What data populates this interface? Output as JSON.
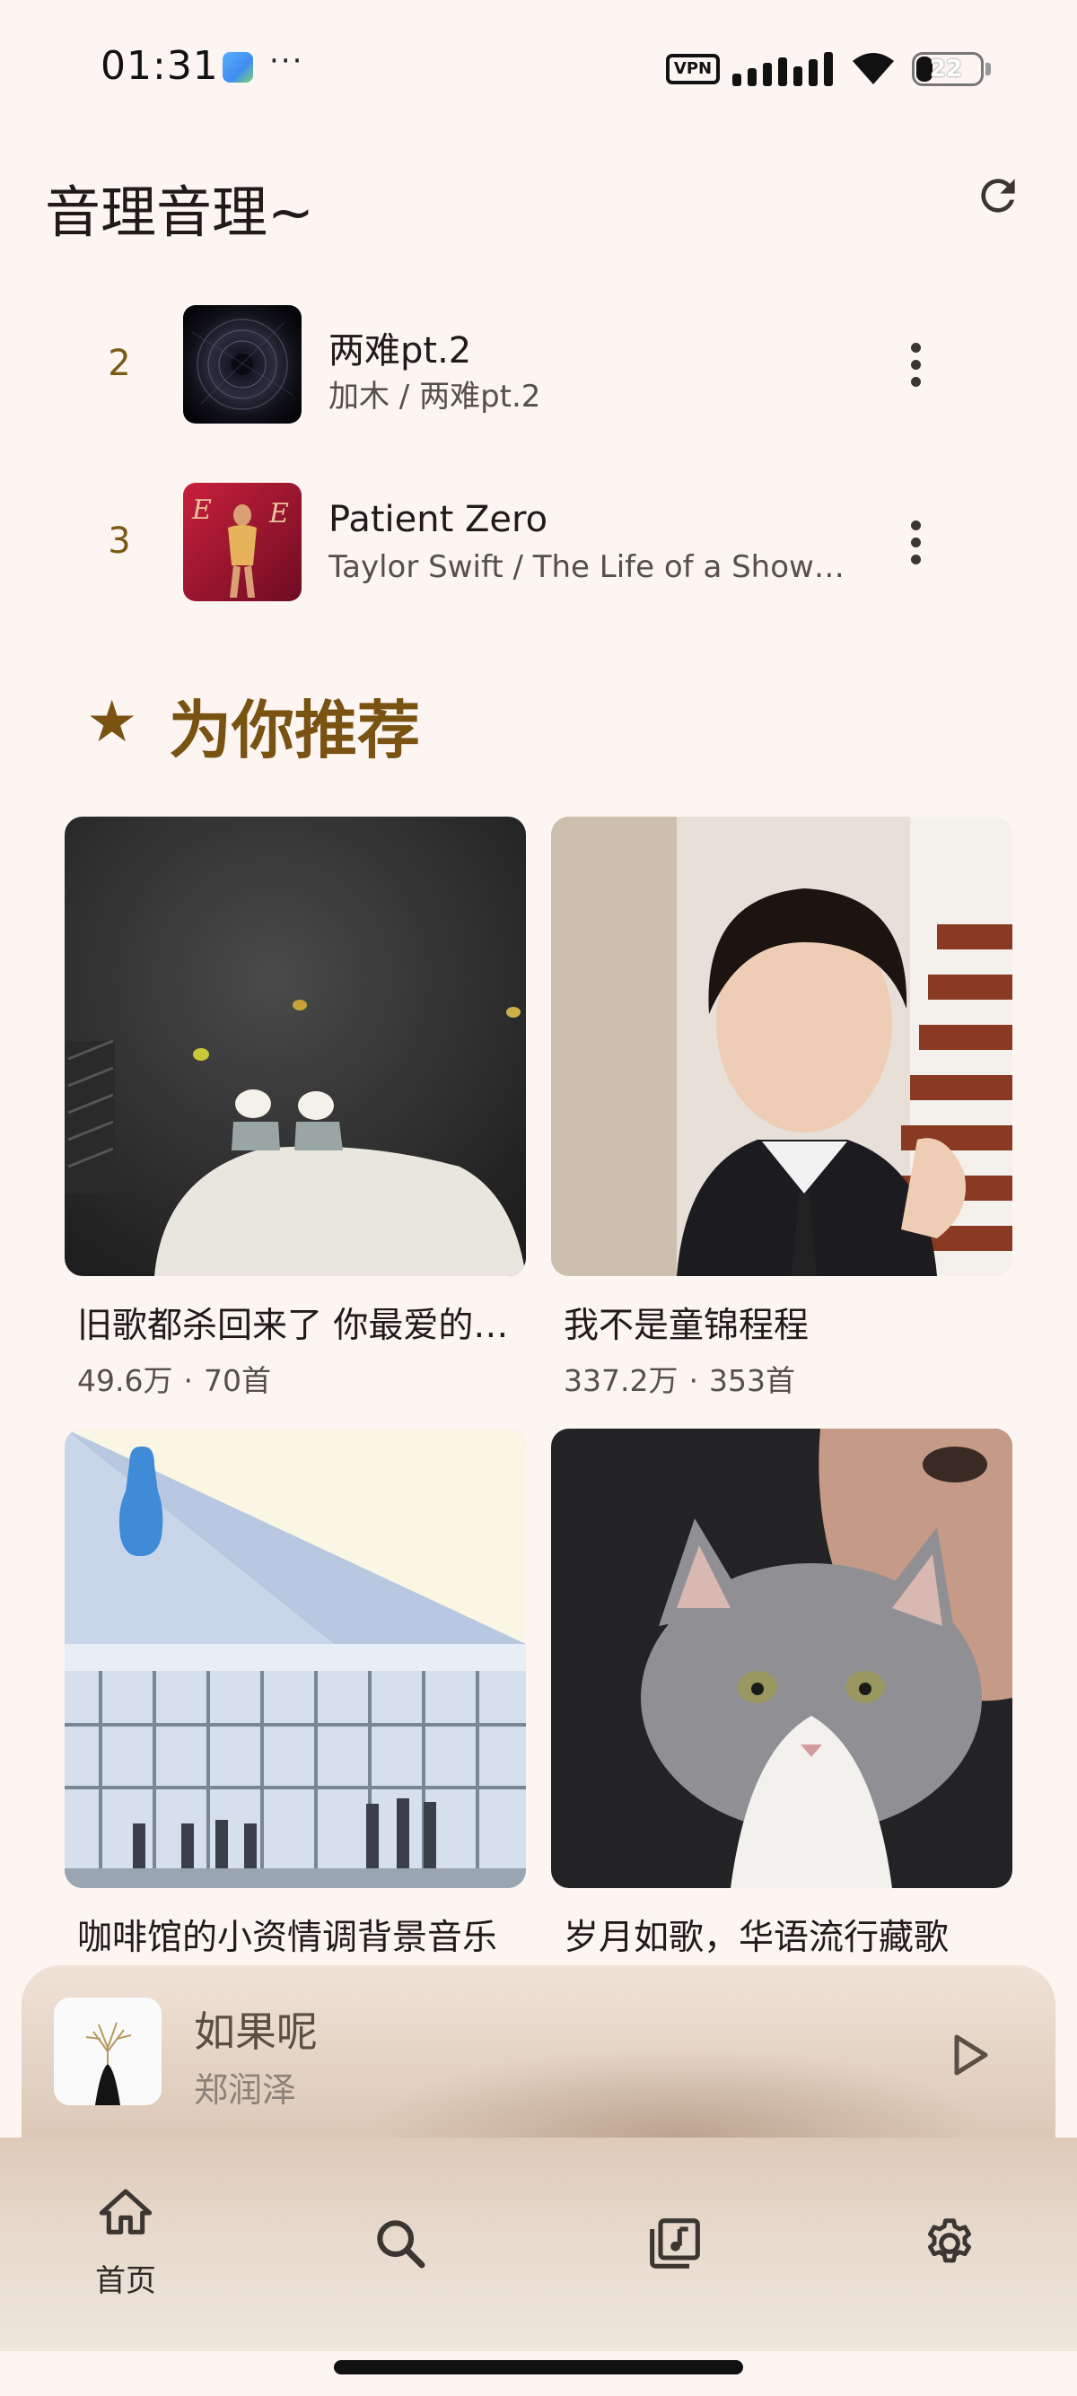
{
  "status_bar": {
    "time": "01:31",
    "dots": "···",
    "vpn": "VPN",
    "battery": "22"
  },
  "header": {
    "title": "音理音理~"
  },
  "tracks": [
    {
      "rank": "2",
      "title": "两难pt.2",
      "subtitle": "加木 / 两难pt.2"
    },
    {
      "rank": "3",
      "title": "Patient Zero",
      "subtitle": "Taylor Swift / The Life of a Showgirl"
    }
  ],
  "recommend": {
    "title": "为你推荐",
    "playlists": [
      {
        "name": "旧歌都杀回来了 你最爱的那首歌",
        "plays": "49.6万",
        "sep": "·",
        "count": "70首"
      },
      {
        "name": "我不是童锦程程",
        "plays": "337.2万",
        "sep": "·",
        "count": "353首"
      },
      {
        "name": "咖啡馆的小资情调背景音乐",
        "plays": "",
        "sep": "",
        "count": ""
      },
      {
        "name": "岁月如歌，华语流行藏歌",
        "plays": "",
        "sep": "",
        "count": ""
      }
    ]
  },
  "now_playing": {
    "title": "如果呢",
    "artist": "郑润泽"
  },
  "nav": {
    "home": "首页"
  },
  "colors": {
    "background": "#fcf5f2",
    "accent": "#7a5212",
    "rank": "#7a5a12"
  }
}
